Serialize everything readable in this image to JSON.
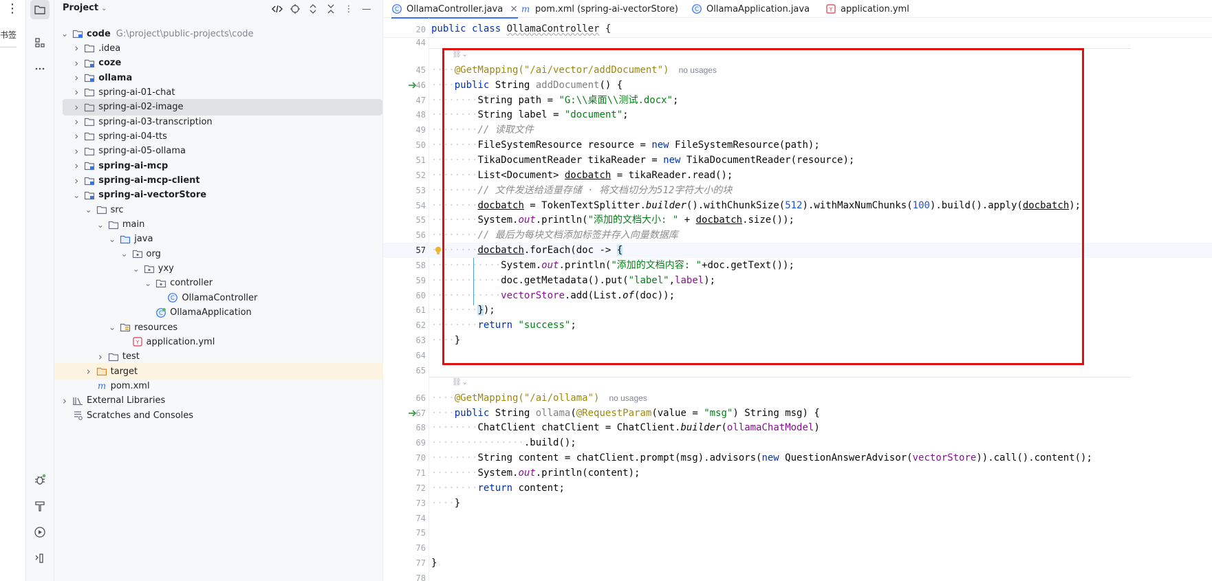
{
  "left_strip": {
    "bookmark_label": "书签"
  },
  "project_panel": {
    "title": "Project",
    "tree": [
      {
        "name": "code",
        "path": "G:\\project\\public-projects\\code",
        "bold": true,
        "depth": 0,
        "expanded": true,
        "icon": "module-folder-icon"
      },
      {
        "name": ".idea",
        "depth": 1,
        "expanded": false,
        "icon": "folder-icon"
      },
      {
        "name": "coze",
        "depth": 1,
        "expanded": false,
        "icon": "module-folder-icon",
        "bold": true
      },
      {
        "name": "ollama",
        "depth": 1,
        "expanded": false,
        "icon": "module-folder-icon",
        "bold": true
      },
      {
        "name": "spring-ai-01-chat",
        "depth": 1,
        "expanded": false,
        "icon": "folder-icon"
      },
      {
        "name": "spring-ai-02-image",
        "depth": 1,
        "expanded": false,
        "icon": "folder-icon",
        "selected": true
      },
      {
        "name": "spring-ai-03-transcription",
        "depth": 1,
        "expanded": false,
        "icon": "folder-icon"
      },
      {
        "name": "spring-ai-04-tts",
        "depth": 1,
        "expanded": false,
        "icon": "folder-icon"
      },
      {
        "name": "spring-ai-05-ollama",
        "depth": 1,
        "expanded": false,
        "icon": "folder-icon"
      },
      {
        "name": "spring-ai-mcp",
        "depth": 1,
        "expanded": false,
        "icon": "module-folder-icon",
        "bold": true
      },
      {
        "name": "spring-ai-mcp-client",
        "depth": 1,
        "expanded": false,
        "icon": "module-folder-icon",
        "bold": true
      },
      {
        "name": "spring-ai-vectorStore",
        "depth": 1,
        "expanded": true,
        "icon": "module-folder-icon",
        "bold": true
      },
      {
        "name": "src",
        "depth": 2,
        "expanded": true,
        "icon": "folder-icon"
      },
      {
        "name": "main",
        "depth": 3,
        "expanded": true,
        "icon": "folder-icon"
      },
      {
        "name": "java",
        "depth": 4,
        "expanded": true,
        "icon": "source-folder-icon"
      },
      {
        "name": "org",
        "depth": 5,
        "expanded": true,
        "icon": "package-icon"
      },
      {
        "name": "yxy",
        "depth": 6,
        "expanded": true,
        "icon": "package-icon"
      },
      {
        "name": "controller",
        "depth": 7,
        "expanded": true,
        "icon": "package-icon"
      },
      {
        "name": "OllamaController",
        "depth": 8,
        "leaf": true,
        "icon": "java-class-icon"
      },
      {
        "name": "OllamaApplication",
        "depth": 7,
        "leaf": true,
        "icon": "spring-boot-class-icon"
      },
      {
        "name": "resources",
        "depth": 4,
        "expanded": true,
        "icon": "resources-folder-icon"
      },
      {
        "name": "application.yml",
        "depth": 5,
        "leaf": true,
        "icon": "yaml-file-icon"
      },
      {
        "name": "test",
        "depth": 3,
        "expanded": false,
        "icon": "folder-icon"
      },
      {
        "name": "target",
        "depth": 2,
        "expanded": false,
        "icon": "excluded-folder-icon",
        "excluded": true
      },
      {
        "name": "pom.xml",
        "depth": 2,
        "leaf": true,
        "icon": "maven-file-icon"
      },
      {
        "name": "External Libraries",
        "depth": 0,
        "expanded": false,
        "icon": "libraries-icon"
      },
      {
        "name": "Scratches and Consoles",
        "depth": 0,
        "leaf": true,
        "icon": "scratches-icon"
      }
    ]
  },
  "editor": {
    "tabs": [
      {
        "label": "OllamaController.java",
        "icon": "java-class-icon",
        "active": true
      },
      {
        "label": "pom.xml (spring-ai-vectorStore)",
        "icon": "maven-file-icon"
      },
      {
        "label": "OllamaApplication.java",
        "icon": "java-class-icon"
      },
      {
        "label": "application.yml",
        "icon": "yaml-file-icon"
      }
    ],
    "sticky": {
      "line_number": "20",
      "kw": "public class",
      "class_name": "OllamaController",
      "tail": " {"
    },
    "line_numbers": [
      "44",
      "45",
      "46",
      "47",
      "48",
      "49",
      "50",
      "51",
      "52",
      "53",
      "54",
      "55",
      "56",
      "57",
      "58",
      "59",
      "60",
      "61",
      "62",
      "63",
      "64",
      "65",
      "66",
      "67",
      "68",
      "69",
      "70",
      "71",
      "72",
      "73",
      "74",
      "75",
      "76",
      "77",
      "78"
    ],
    "annotation_1": "@GetMapping(\"/ai/vector/addDocument\")",
    "annotation_2": "@GetMapping(\"/ai/ollama\")",
    "usage_hint": "no usages",
    "comment_read": "// 读取文件",
    "comment_split": "// 文件发送给适量存储 · 将文档切分为512字符大小的块",
    "comment_tag": "// 最后为每块文档添加标签并存入向量数据库",
    "str_path": "\"G:\\\\桌面\\\\测试.docx\"",
    "str_document": "\"document\"",
    "str_size": "\"添加的文档大小: \"",
    "str_content": "\"添加的文档内容: \"",
    "str_label": "\"label\"",
    "str_success": "\"success\"",
    "str_msg": "\"msg\"",
    "num_512": "512",
    "num_100": "100"
  }
}
